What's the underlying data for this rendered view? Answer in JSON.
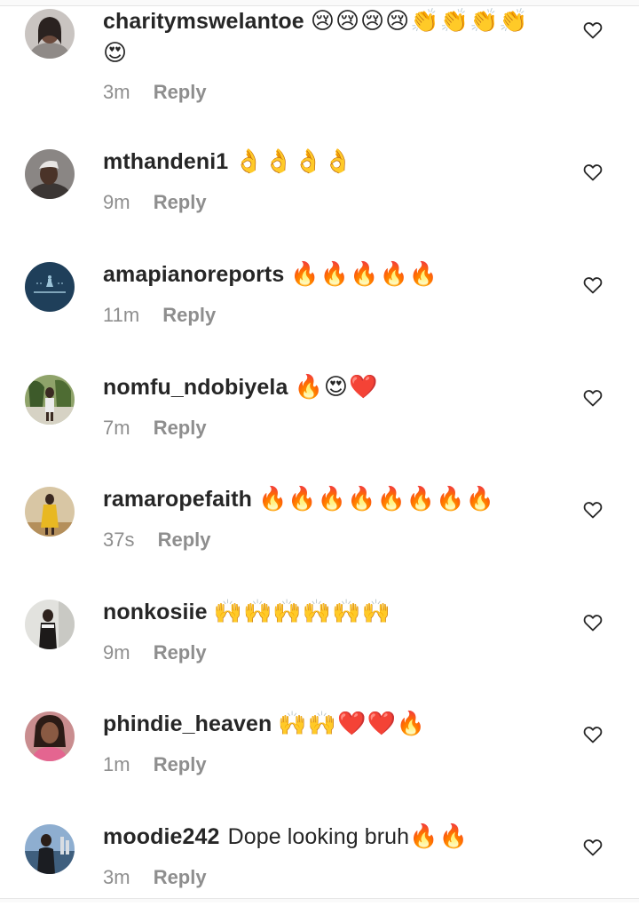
{
  "reply_label": "Reply",
  "colors": {
    "username": "#262626",
    "meta": "#8e8e8e",
    "fire": "#f5640a",
    "heart": "#e8203a"
  },
  "comments": [
    {
      "username": "charitymswelantoe",
      "text": "",
      "emoji": "😢😢😢😢👏👏👏👏",
      "emoji_line2": "😍",
      "time": "3m",
      "avatar_icon": "woman-avatar-grey",
      "avatar_color": "#bcb6b2"
    },
    {
      "username": "mthandeni1",
      "text": "",
      "emoji": "👌👌👌👌",
      "time": "9m",
      "avatar_icon": "man-avatar",
      "avatar_color": "#7f7c7a"
    },
    {
      "username": "amapianoreports",
      "text": "",
      "emoji": "🔥🔥🔥🔥🔥",
      "time": "11m",
      "avatar_icon": "amapiano-reports-logo",
      "avatar_color": "#1f3f5a"
    },
    {
      "username": "nomfu_ndobiyela",
      "text": "",
      "emoji": "🔥😍❤️",
      "time": "7m",
      "avatar_icon": "woman-outdoor-avatar",
      "avatar_color": "#5f7a3f"
    },
    {
      "username": "ramaropefaith",
      "text": "",
      "emoji": "🔥🔥🔥🔥🔥🔥🔥🔥",
      "time": "37s",
      "avatar_icon": "woman-yellow-dress-avatar",
      "avatar_color": "#c9a771"
    },
    {
      "username": "nonkosiie",
      "text": "",
      "emoji": "🙌🙌🙌🙌🙌🙌",
      "time": "9m",
      "avatar_icon": "woman-indoor-avatar",
      "avatar_color": "#dcdcd8"
    },
    {
      "username": "phindie_heaven",
      "text": "",
      "emoji": "🙌🙌❤️❤️🔥",
      "time": "1m",
      "avatar_icon": "woman-pink-avatar",
      "avatar_color": "#c27f83"
    },
    {
      "username": "moodie242",
      "text": "Dope looking bruh",
      "emoji": "🔥🔥",
      "time": "3m",
      "avatar_icon": "man-waterfront-avatar",
      "avatar_color": "#5d7da0"
    }
  ]
}
